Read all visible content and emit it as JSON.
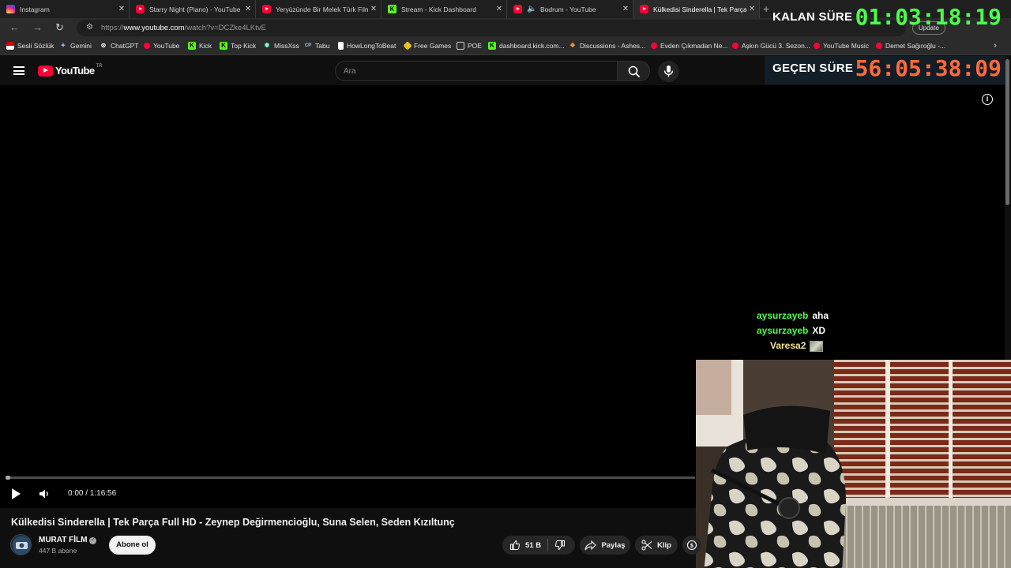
{
  "browser": {
    "tabs": [
      {
        "title": "Instagram",
        "icon": "instagram-icon"
      },
      {
        "title": "Starry Night (Piano) - YouTube",
        "icon": "youtube-icon"
      },
      {
        "title": "Yeryüzünde Bir Melek Türk Filmi |",
        "icon": "youtube-icon"
      },
      {
        "title": "Stream - Kick Dashboard",
        "icon": "kick-icon"
      },
      {
        "title": "Bodrum - YouTube",
        "icon": "youtube-icon"
      },
      {
        "title": "Külkedisi Sinderella | Tek Parça Fu",
        "icon": "youtube-icon",
        "active": true
      }
    ],
    "url_prefix": "https://",
    "url_host": "www.youtube.com",
    "url_path": "/watch?v=DCZke4LKtvE",
    "update_label": "Update",
    "bookmarks": [
      {
        "label": "Sesli Sözlük",
        "icon": "flag-icon"
      },
      {
        "label": "Gemini",
        "icon": "gemini-icon"
      },
      {
        "label": "ChatGPT",
        "icon": "chatgpt-icon"
      },
      {
        "label": "YouTube",
        "icon": "youtube-icon"
      },
      {
        "label": "Kick",
        "icon": "kick-icon"
      },
      {
        "label": "Top Kick",
        "icon": "kick-icon"
      },
      {
        "label": "MissXss",
        "icon": "star-icon"
      },
      {
        "label": "Tabu",
        "icon": "cp-icon"
      },
      {
        "label": "HowLongToBeat",
        "icon": "hltb-icon"
      },
      {
        "label": "Free Games",
        "icon": "tag-icon"
      },
      {
        "label": "POE",
        "icon": "folder-icon"
      },
      {
        "label": "dashboard.kick.com...",
        "icon": "kick-icon"
      },
      {
        "label": "Discussions - Ashes...",
        "icon": "discussions-icon"
      },
      {
        "label": "Evden Çıkmadan Ne...",
        "icon": "youtube-icon"
      },
      {
        "label": "Aşkın Gücü 3. Sezon...",
        "icon": "youtube-icon"
      },
      {
        "label": "YouTube Music",
        "icon": "youtube-music-icon"
      },
      {
        "label": "Demet Sağıroğlu -...",
        "icon": "youtube-icon"
      }
    ]
  },
  "youtube": {
    "logo_text": "YouTube",
    "region": "TR",
    "search_placeholder": "Ara"
  },
  "timers": {
    "remaining_label": "KALAN SÜRE",
    "remaining_value": "01:03:18:19",
    "remaining_color": "#4cff4c",
    "elapsed_label": "GEÇEN SÜRE",
    "elapsed_value": "56:05:38:09",
    "elapsed_color": "#ff6a3c"
  },
  "player": {
    "time_display": "0:00 / 1:16:56",
    "progress": 0.0
  },
  "chat": [
    {
      "user": "aysurzayeb",
      "message": "aha",
      "user_color": "#4cff4c"
    },
    {
      "user": "aysurzayeb",
      "message": "XD",
      "user_color": "#4cff4c"
    },
    {
      "user": "Varesa2",
      "message": "",
      "emote": "image-emote",
      "user_color": "#f3e39a"
    }
  ],
  "video": {
    "title": "Külkedisi Sinderella | Tek Parça Full HD - Zeynep Değirmencioğlu, Suna Selen, Seden Kızıltunç",
    "channel_name": "MURAT FİLM",
    "subscribers": "447 B abone",
    "subscribe_label": "Abone ol",
    "likes": "51 B",
    "share_label": "Paylaş",
    "clip_label": "Klip"
  }
}
